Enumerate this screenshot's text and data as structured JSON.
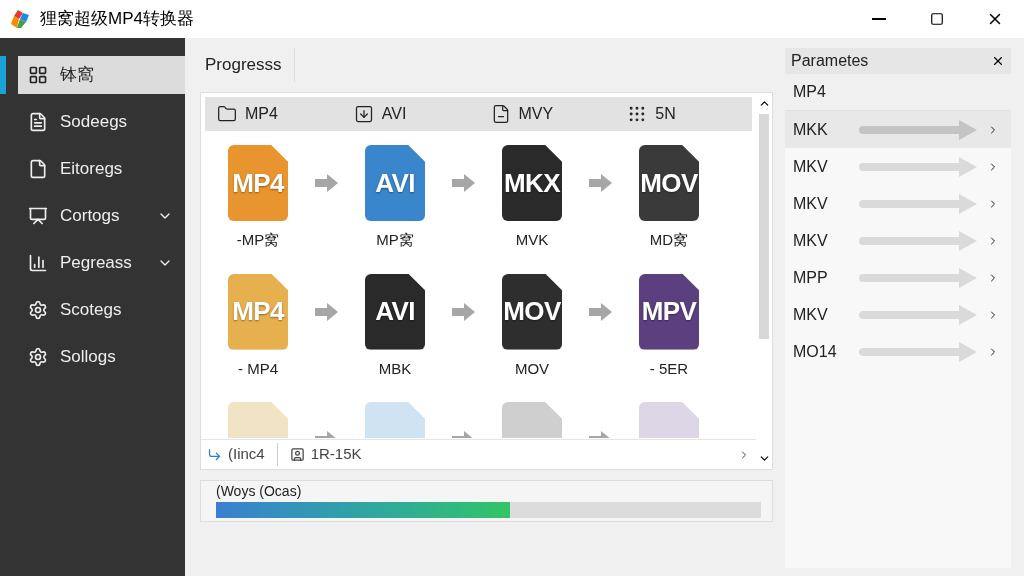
{
  "window": {
    "title": "狸窝超级MP4转换器"
  },
  "sidebar": {
    "items": [
      {
        "kind": "grid",
        "label": "钵窩",
        "selected": true,
        "expandable": false
      },
      {
        "kind": "doc",
        "label": "Sodeegs",
        "selected": false,
        "expandable": false
      },
      {
        "kind": "doc2",
        "label": "Eitoregs",
        "selected": false,
        "expandable": false
      },
      {
        "kind": "screen",
        "label": "Cortogs",
        "selected": false,
        "expandable": true
      },
      {
        "kind": "chart",
        "label": "Pegreass",
        "selected": false,
        "expandable": true
      },
      {
        "kind": "gear",
        "label": "Scotegs",
        "selected": false,
        "expandable": false
      },
      {
        "kind": "gear",
        "label": "Sollogs",
        "selected": false,
        "expandable": false
      }
    ]
  },
  "main": {
    "tab": "Progresss",
    "toolbar": [
      {
        "kind": "folder",
        "label": "MP4"
      },
      {
        "kind": "import",
        "label": "AVI"
      },
      {
        "kind": "file",
        "label": "MVY"
      },
      {
        "kind": "dots",
        "label": "5N"
      }
    ],
    "rows": [
      [
        {
          "badge": "MP4",
          "label": "-MP窝",
          "color": "#e8952f"
        },
        {
          "badge": "AVI",
          "label": "MP窝",
          "color": "#3a86cc"
        },
        {
          "badge": "MKX",
          "label": "MVK",
          "color": "#2a2a2a"
        },
        {
          "badge": "MOV",
          "label": "MD窝",
          "color": "#3a3a3a"
        }
      ],
      [
        {
          "badge": "MP4",
          "label": "- MP4",
          "color": "#e6b04e"
        },
        {
          "badge": "AVI",
          "label": "MBK",
          "color": "#2a2a2a"
        },
        {
          "badge": "MOV",
          "label": "MOV",
          "color": "#2e2e2e"
        },
        {
          "badge": "MPV",
          "label": "- 5ER",
          "color": "#5c3f7e"
        }
      ],
      [
        {
          "color": "#f1e3c6"
        },
        {
          "color": "#cfe3f3"
        },
        {
          "color": "#cfcfcf"
        },
        {
          "color": "#ddd6e6"
        }
      ]
    ],
    "status": [
      {
        "kind": "arrow",
        "label": "(Iinc4"
      },
      {
        "kind": "face",
        "label": "1R-15K"
      }
    ],
    "progress": {
      "label": "(Woys (Ocas)",
      "level": 0.54
    }
  },
  "parameters": {
    "title": "Parametes",
    "header": "MP4",
    "items": [
      {
        "label": "MKK",
        "selected": true
      },
      {
        "label": "MKV",
        "selected": false
      },
      {
        "label": "MKV",
        "selected": false
      },
      {
        "label": "MKV",
        "selected": false
      },
      {
        "label": "MPP",
        "selected": false
      },
      {
        "label": "MKV",
        "selected": false
      },
      {
        "label": "MO14",
        "selected": false
      }
    ]
  }
}
